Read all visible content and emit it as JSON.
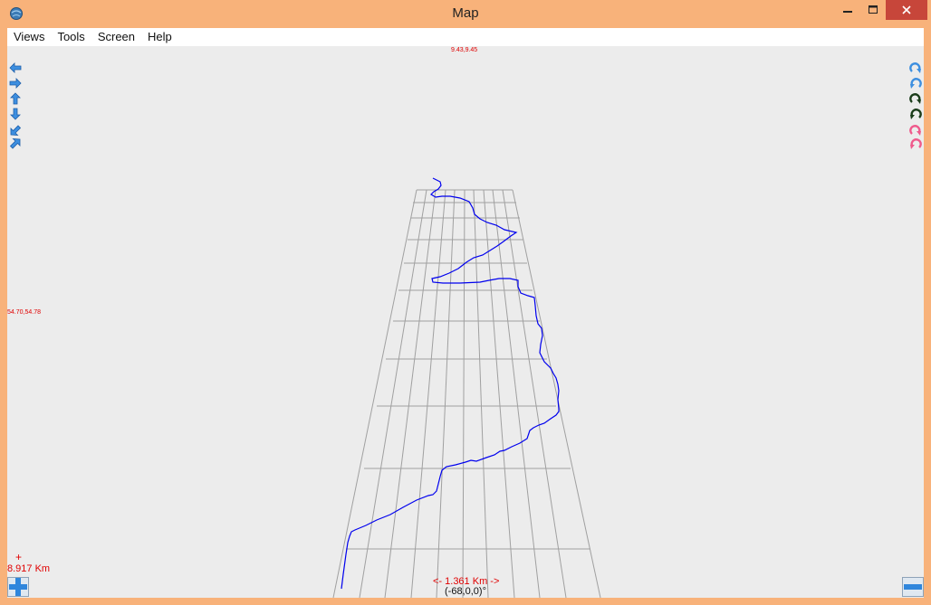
{
  "window": {
    "title": "Map"
  },
  "menu": {
    "items": [
      "Views",
      "Tools",
      "Screen",
      "Help"
    ]
  },
  "map": {
    "top_coord": "9.43,9.45",
    "side_coord": "54.70,54.78",
    "vertical_scale": "8.917 Km",
    "vertical_scale_marker": "+",
    "horizontal_scale": "<- 1.361 Km ->",
    "view_angle": "(-68,0,0)°"
  },
  "left_toolbar": [
    "arrow-left-icon",
    "arrow-right-icon",
    "arrow-up-icon",
    "arrow-down-icon",
    "arrow-diag-down-left-icon",
    "arrow-diag-up-right-icon"
  ],
  "right_toolbar": [
    "rotate-cw-blue-icon",
    "rotate-ccw-blue-icon",
    "rotate-cw-dark-icon",
    "rotate-ccw-dark-icon",
    "rotate-cw-pink-icon",
    "rotate-ccw-pink-icon"
  ],
  "colors": {
    "titlebar": "#f8b27a",
    "close": "#c7463a",
    "canvas": "#ececec",
    "grid": "#a0a0a0",
    "track": "#0000ee",
    "label": "#e00000"
  }
}
